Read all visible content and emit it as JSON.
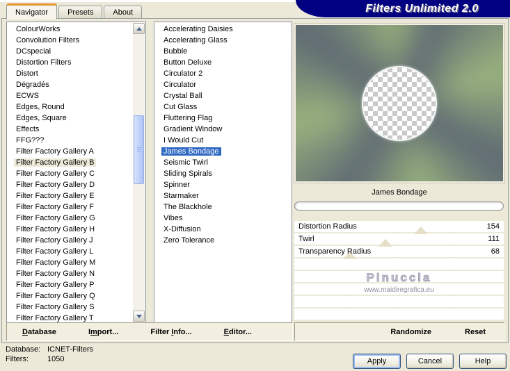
{
  "window_title": "Filters Unlimited 2.0",
  "tabs": {
    "selected_index": 0,
    "items": [
      "Navigator",
      "Presets",
      "About"
    ]
  },
  "category_list": {
    "selected_index": 12,
    "items": [
      "ColourWorks",
      "Convolution Filters",
      "DCspecial",
      "Distortion Filters",
      "Distort",
      "Dégradés",
      "ECWS",
      "Edges, Round",
      "Edges, Square",
      "Effects",
      "FFG???",
      "Filter Factory Gallery A",
      "Filter Factory Gallery B",
      "Filter Factory Gallery C",
      "Filter Factory Gallery D",
      "Filter Factory Gallery E",
      "Filter Factory Gallery F",
      "Filter Factory Gallery G",
      "Filter Factory Gallery H",
      "Filter Factory Gallery J",
      "Filter Factory Gallery L",
      "Filter Factory Gallery M",
      "Filter Factory Gallery N",
      "Filter Factory Gallery P",
      "Filter Factory Gallery Q",
      "Filter Factory Gallery S",
      "Filter Factory Gallery T"
    ]
  },
  "filter_list": {
    "selected_index": 11,
    "items": [
      "Accelerating Daisies",
      "Accelerating Glass",
      "Bubble",
      "Button Deluxe",
      "Circulator 2",
      "Circulator",
      "Crystal Ball",
      "Cut Glass",
      "Fluttering Flag",
      "Gradient Window",
      "I Would Cut",
      "James Bondage",
      "Seismic Twirl",
      "Sliding Spirals",
      "Spinner",
      "Starmaker",
      "The Blackhole",
      "Vibes",
      "X-Diffusion",
      "Zero Tolerance"
    ]
  },
  "preview": {
    "filter_name": "James Bondage"
  },
  "sliders": {
    "max": 255,
    "items": [
      {
        "label": "Distortion Radius",
        "value": 154
      },
      {
        "label": "Twirl",
        "value": 111
      },
      {
        "label": "Transparency Radius",
        "value": 68
      }
    ]
  },
  "watermark": {
    "title": "Pinuccia",
    "url": "www.maidiregrafica.eu"
  },
  "toolbar": {
    "database": "Database",
    "import": "Import...",
    "filter_info": "Filter Info...",
    "editor": "Editor...",
    "randomize": "Randomize",
    "reset": "Reset"
  },
  "status": {
    "database_label": "Database:",
    "database_value": "ICNET-Filters",
    "filters_label": "Filters:",
    "filters_value": "1050"
  },
  "actions": {
    "apply": "Apply",
    "cancel": "Cancel",
    "help": "Help"
  },
  "colors": {
    "dialog_bg": "#ece9d8",
    "title_band": "#010080",
    "selection_blue": "#316ac5",
    "tab_accent": "#e6962e",
    "swirl_green": "#9ab37e",
    "swirl_gray": "#5f6a73"
  }
}
